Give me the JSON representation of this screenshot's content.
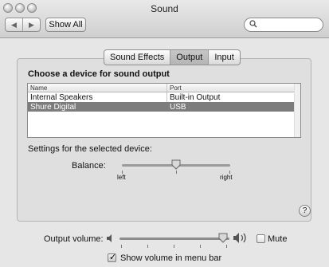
{
  "window": {
    "title": "Sound"
  },
  "toolbar": {
    "show_all_label": "Show All",
    "search_placeholder": ""
  },
  "tabs": [
    {
      "label": "Sound Effects",
      "active": false
    },
    {
      "label": "Output",
      "active": true
    },
    {
      "label": "Input",
      "active": false
    }
  ],
  "output": {
    "section_title": "Choose a device for sound output",
    "columns": [
      "Name",
      "Port"
    ],
    "rows": [
      {
        "name": "Internal Speakers",
        "port": "Built-in Output",
        "selected": false
      },
      {
        "name": "Shure Digital",
        "port": "USB",
        "selected": true
      }
    ],
    "settings_label": "Settings for the selected device:",
    "balance": {
      "label": "Balance:",
      "left_label": "left",
      "right_label": "right",
      "value": 0.5
    }
  },
  "bottom": {
    "volume_label": "Output volume:",
    "volume_value": 0.9,
    "mute_label": "Mute",
    "mute_checked": false,
    "menu_bar_label": "Show volume in menu bar",
    "menu_bar_checked": true
  },
  "icons": {
    "nav_back": "◀",
    "nav_forward": "▶",
    "search": "magnifier-icon",
    "help": "?"
  }
}
